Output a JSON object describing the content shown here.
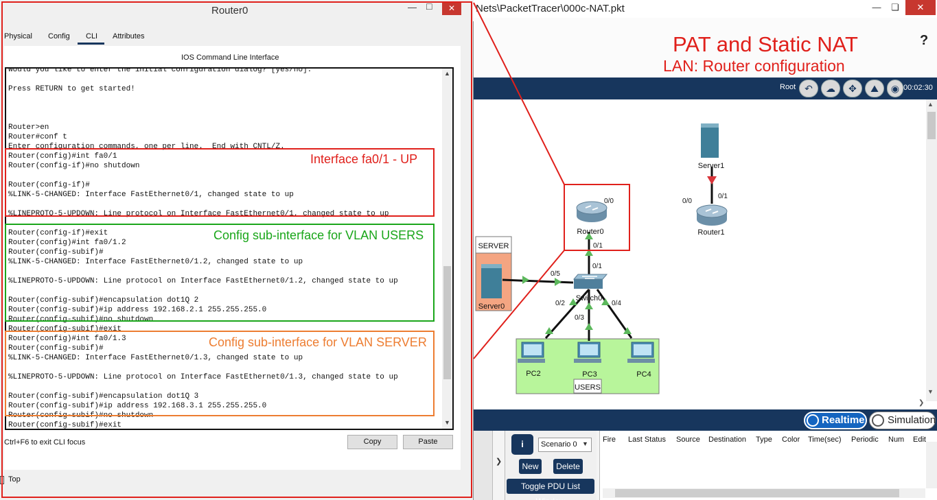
{
  "pt_window": {
    "title": "Nets\\PacketTracer\\000c-NAT.pkt",
    "minimize_icon": "minimize-icon",
    "maximize_icon": "maximize-icon",
    "close_icon": "close-icon"
  },
  "slide": {
    "title": "PAT and Static NAT",
    "subtitle": "LAN: Router configuration",
    "help": "?"
  },
  "logical_bar": {
    "root_label": "Root",
    "time": "00:02:30",
    "icons": [
      "back-icon",
      "cloud-icon",
      "move-icon",
      "image-icon",
      "viewport-icon"
    ]
  },
  "topology": {
    "devices": {
      "router0": "Router0",
      "router1": "Router1",
      "server1": "Server1",
      "server0": "Server0",
      "switch0": "Switch0",
      "pc2": "PC2",
      "pc3": "PC3",
      "pc4": "PC4"
    },
    "ports": {
      "r0_top": "0/0",
      "r0_bottom": "0/1",
      "r1_left": "0/0",
      "r1_right": "0/1",
      "sw_up": "0/1",
      "sw_left": "0/5",
      "sw_p2": "0/2",
      "sw_p3": "0/3",
      "sw_p4": "0/4"
    },
    "areas": {
      "server_area": "SERVER",
      "users_area": "USERS"
    }
  },
  "mode": {
    "realtime": "Realtime",
    "simulation": "Simulation"
  },
  "pdu_panel": {
    "info": "i",
    "scenario": "Scenario 0",
    "new_label": "New",
    "delete_label": "Delete",
    "toggle_label": "Toggle PDU List Window",
    "columns": [
      "Fire",
      "Last Status",
      "Source",
      "Destination",
      "Type",
      "Color",
      "Time(sec)",
      "Periodic",
      "Num",
      "Edit"
    ]
  },
  "router_window": {
    "title": "Router0",
    "tabs": [
      "Physical",
      "Config",
      "CLI",
      "Attributes"
    ],
    "cli_header": "IOS Command Line Interface",
    "cli_lines": [
      "Would you like to enter the initial configuration dialog? [yes/no]:",
      "",
      "Press RETURN to get started!",
      "",
      "",
      "",
      "Router>en",
      "Router#conf t",
      "Enter configuration commands, one per line.  End with CNTL/Z.",
      "Router(config)#int fa0/1",
      "Router(config-if)#no shutdown",
      "",
      "Router(config-if)#",
      "%LINK-5-CHANGED: Interface FastEthernet0/1, changed state to up",
      "",
      "%LINEPROTO-5-UPDOWN: Line protocol on Interface FastEthernet0/1, changed state to up",
      "",
      "Router(config-if)#exit",
      "Router(config)#int fa0/1.2",
      "Router(config-subif)#",
      "%LINK-5-CHANGED: Interface FastEthernet0/1.2, changed state to up",
      "",
      "%LINEPROTO-5-UPDOWN: Line protocol on Interface FastEthernet0/1.2, changed state to up",
      "",
      "Router(config-subif)#encapsulation dot1Q 2",
      "Router(config-subif)#ip address 192.168.2.1 255.255.255.0",
      "Router(config-subif)#no shutdown",
      "Router(config-subif)#exit",
      "Router(config)#int fa0/1.3",
      "Router(config-subif)#",
      "%LINK-5-CHANGED: Interface FastEthernet0/1.3, changed state to up",
      "",
      "%LINEPROTO-5-UPDOWN: Line protocol on Interface FastEthernet0/1.3, changed state to up",
      "",
      "Router(config-subif)#encapsulation dot1Q 3",
      "Router(config-subif)#ip address 192.168.3.1 255.255.255.0",
      "Router(config-subif)#no shutdown",
      "Router(config-subif)#exit"
    ],
    "ctrl_hint": "Ctrl+F6 to exit CLI focus",
    "copy_label": "Copy",
    "paste_label": "Paste",
    "top_label": "Top"
  },
  "annotations": {
    "interface_up": "Interface fa0/1 - UP",
    "vlan_users": "Config sub-interface for VLAN USERS",
    "vlan_server": "Config sub-interface for VLAN SERVER"
  },
  "colors": {
    "annotation_red": "#e0201b",
    "annotation_green": "#1aa61a",
    "annotation_orange": "#ed7d31",
    "toolbar_navy": "#17365d",
    "link_up_green": "#5cb85c",
    "link_down_red": "#d9343a",
    "users_area_fill": "#b8f59b",
    "server_area_fill": "#f4a582"
  }
}
